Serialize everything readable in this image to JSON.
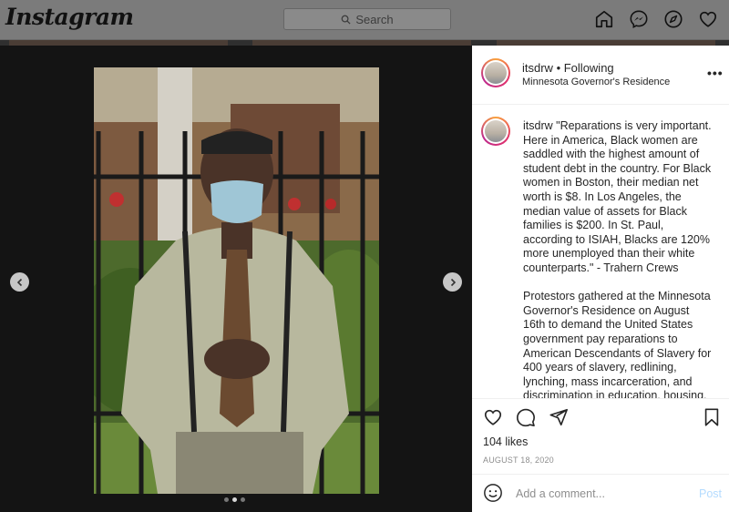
{
  "header": {
    "logo": "Instagram",
    "search_placeholder": "Search",
    "icons": [
      "home-icon",
      "messenger-icon",
      "explore-icon",
      "heart-icon"
    ]
  },
  "post": {
    "image_description_icon": "photo",
    "carousel": {
      "total": 3,
      "active": 2
    }
  },
  "panel": {
    "username": "itsdrw",
    "following_label": "• Following",
    "location": "Minnesota Governor's Residence",
    "more_label": "•••",
    "caption_username": "itsdrw",
    "caption_p1": "\"Reparations is very important. Here in America, Black women are saddled with the highest amount of student debt in the country. For Black women in Boston, their median net worth is $8. In Los Angeles, the median value of assets for Black families is $200. In St. Paul, according to ISIAH, Blacks are 120% more unemployed than their white counterparts.\" - Trahern Crews",
    "caption_p2": "Protestors gathered at the Minnesota Governor's Residence on August 16th to demand the United States government pay reparations to American Descendants of Slavery for 400 years of slavery, redlining, lynching, mass incarceration, and discrimination in education, housing,",
    "likes": "104 likes",
    "date": "AUGUST 18, 2020",
    "comment_placeholder": "Add a comment...",
    "post_label": "Post"
  },
  "colors": {
    "link_disabled": "#b3dbff",
    "text": "#262626",
    "muted": "#8e8e8e"
  }
}
